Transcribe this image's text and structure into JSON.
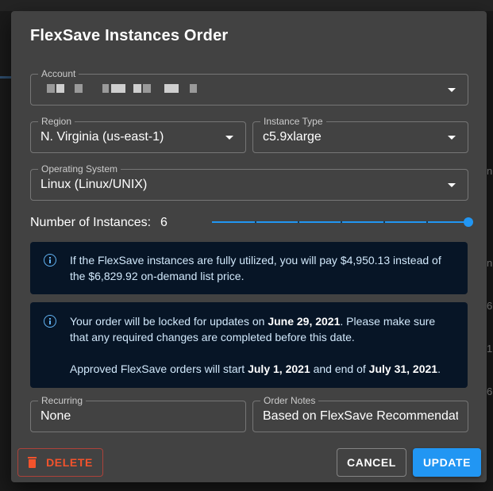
{
  "dialog": {
    "title": "FlexSave Instances Order"
  },
  "account": {
    "label": "Account",
    "value": ""
  },
  "region": {
    "label": "Region",
    "value": "N. Virginia (us-east-1)"
  },
  "instance_type": {
    "label": "Instance Type",
    "value": "c5.9xlarge"
  },
  "operating_system": {
    "label": "Operating System",
    "value": "Linux (Linux/UNIX)"
  },
  "instances": {
    "label": "Number of Instances:",
    "value": "6",
    "slider_fraction": 1.0
  },
  "alert_pricing": {
    "icon": "info-icon",
    "line1": "If the FlexSave instances are fully utilized, you will pay $4,950.13 instead of",
    "line2": "the $6,829.92 on-demand list price."
  },
  "alert_schedule": {
    "icon": "info-icon",
    "p1_a": "Your order will be locked for updates on ",
    "p1_date": "June 29, 2021",
    "p1_b": ". Please make sure",
    "p1_line2": "that any required changes are completed before this date.",
    "p2_a": "Approved FlexSave orders will start ",
    "p2_start": "July 1, 2021",
    "p2_b": " and end of ",
    "p2_end": "July 31, 2021",
    "p2_c": "."
  },
  "recurring": {
    "label": "Recurring",
    "value": "None"
  },
  "order_notes": {
    "label": "Order Notes",
    "value": "Based on FlexSave Recommendati"
  },
  "buttons": {
    "delete_label": "Delete",
    "cancel_label": "Cancel",
    "update_label": "Update"
  },
  "background": {
    "right_edge_chars": [
      "n",
      "n",
      "6",
      "1",
      "6"
    ]
  },
  "colors": {
    "dialog_bg": "#424242",
    "accent": "#2196f3",
    "danger": "#f4532c",
    "alert_bg": "#071526"
  }
}
